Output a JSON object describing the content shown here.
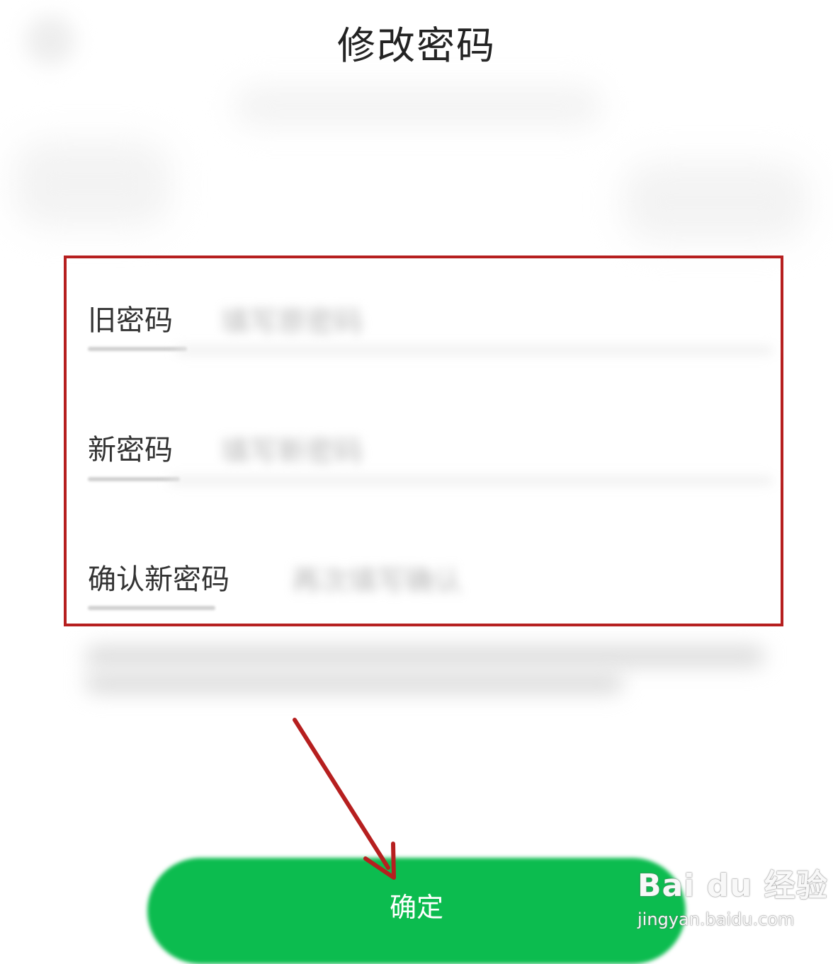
{
  "header": {
    "title": "修改密码"
  },
  "form": {
    "fields": [
      {
        "label": "旧密码",
        "placeholder": "填写原密码"
      },
      {
        "label": "新密码",
        "placeholder": "填写新密码"
      },
      {
        "label": "确认新密码",
        "placeholder": "再次填写确认"
      }
    ]
  },
  "actions": {
    "confirm_label": "确定"
  },
  "watermark": {
    "brand": "Bai du 经验",
    "url": "jingyan.baidu.com"
  },
  "colors": {
    "accent": "#0cbc4f",
    "annotation": "#b61f1f"
  }
}
